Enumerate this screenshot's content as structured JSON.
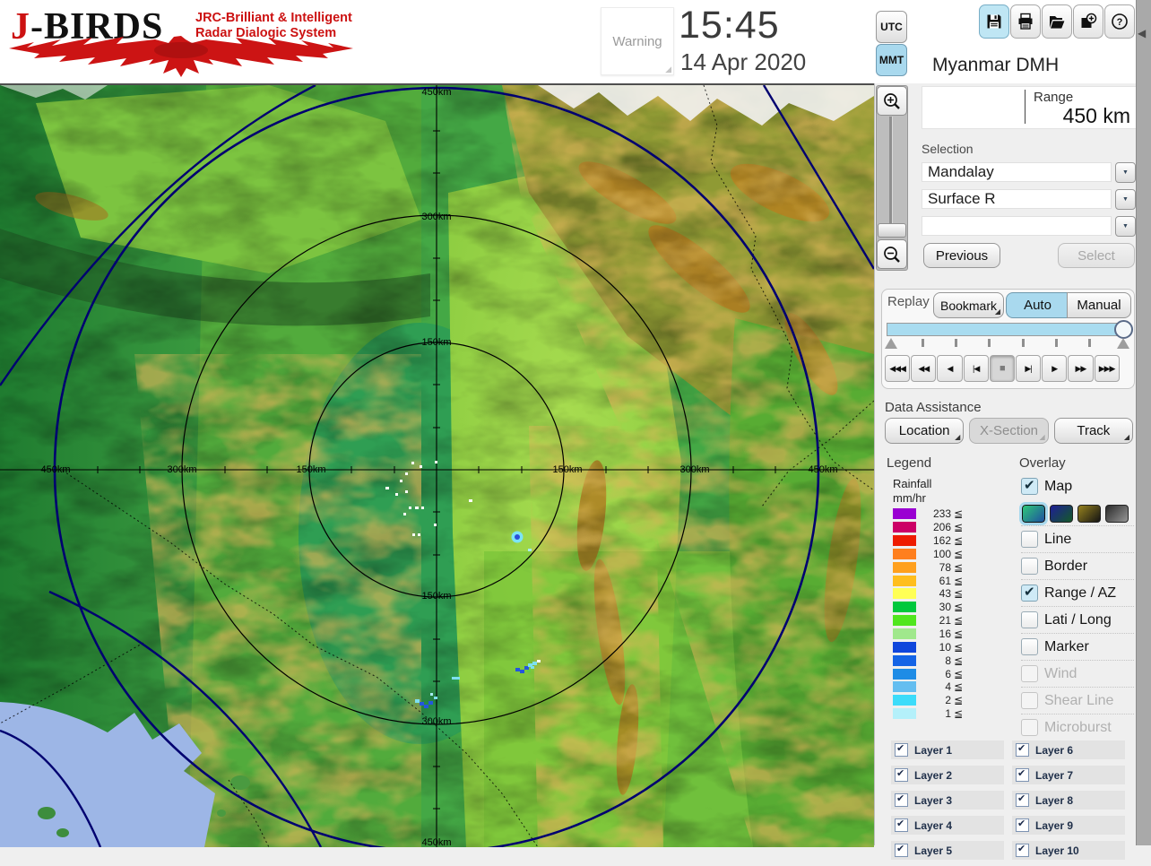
{
  "header": {
    "logo": {
      "j": "J",
      "rest": "-BIRDS",
      "sub1": "JRC-Brilliant & Intelligent",
      "sub2": "Radar  Dialogic  System"
    },
    "warning_label": "Warning",
    "clock": {
      "time": "15:45",
      "date": "14 Apr 2020"
    },
    "timezone": {
      "utc": "UTC",
      "mmt": "MMT",
      "selected": "MMT"
    },
    "toolbar_icons": [
      "save",
      "print",
      "open",
      "export-image",
      "help"
    ]
  },
  "station_panel": {
    "station_name": "Myanmar DMH",
    "range_label": "Range",
    "range_value": "450 km",
    "selection_label": "Selection",
    "dropdowns": [
      {
        "value": "Mandalay"
      },
      {
        "value": "Surface R"
      },
      {
        "value": ""
      }
    ],
    "previous_label": "Previous",
    "select_label": "Select"
  },
  "replay": {
    "label": "Replay",
    "bookmark_label": "Bookmark",
    "auto_label": "Auto",
    "manual_label": "Manual",
    "mode_selected": "Auto",
    "playback_buttons": [
      {
        "glyph": "◀◀◀",
        "name": "fast-rewind"
      },
      {
        "glyph": "◀◀",
        "name": "rewind"
      },
      {
        "glyph": "◀",
        "name": "play-backward"
      },
      {
        "glyph": "|◀",
        "name": "step-back"
      },
      {
        "glyph": "■",
        "name": "stop",
        "pressed": true
      },
      {
        "glyph": "▶|",
        "name": "step-forward"
      },
      {
        "glyph": "▶",
        "name": "play"
      },
      {
        "glyph": "▶▶",
        "name": "fast-forward"
      },
      {
        "glyph": "▶▶▶",
        "name": "skip-to-end"
      }
    ]
  },
  "data_assistance": {
    "label": "Data Assistance",
    "buttons": [
      {
        "label": "Location",
        "disabled": false
      },
      {
        "label": "X-Section",
        "disabled": true
      },
      {
        "label": "Track",
        "disabled": false
      }
    ]
  },
  "legend": {
    "label": "Legend",
    "unit1": "Rainfall",
    "unit2": "mm/hr",
    "lte": "≦",
    "rows": [
      {
        "value": "233",
        "color": "#9a00d2"
      },
      {
        "value": "206",
        "color": "#cc0066"
      },
      {
        "value": "162",
        "color": "#ee1c00"
      },
      {
        "value": "100",
        "color": "#ff7f1e"
      },
      {
        "value": "78",
        "color": "#ffa01e"
      },
      {
        "value": "61",
        "color": "#ffbe1e"
      },
      {
        "value": "43",
        "color": "#ffff55"
      },
      {
        "value": "30",
        "color": "#00c83c"
      },
      {
        "value": "21",
        "color": "#50e61e"
      },
      {
        "value": "16",
        "color": "#a0e88c"
      },
      {
        "value": "10",
        "color": "#0f46dc"
      },
      {
        "value": "8",
        "color": "#1464e6"
      },
      {
        "value": "6",
        "color": "#1e8ce6"
      },
      {
        "value": "4",
        "color": "#64bef0"
      },
      {
        "value": "2",
        "color": "#3cdcfa"
      },
      {
        "value": "1",
        "color": "#b4f0fa"
      }
    ]
  },
  "overlay": {
    "label": "Overlay",
    "items_top": [
      {
        "label": "Map",
        "checked": true
      }
    ],
    "swatches": [
      {
        "gradient": "linear-gradient(135deg,#2ec878,#1e50a0)",
        "selected": true
      },
      {
        "gradient": "linear-gradient(135deg,#1e1e96,#145a28)"
      },
      {
        "gradient": "linear-gradient(135deg,#96821e,#141414)"
      },
      {
        "gradient": "linear-gradient(135deg,#2a2a2a,#969696)"
      }
    ],
    "items": [
      {
        "label": "Line"
      },
      {
        "label": "Border"
      },
      {
        "label": "Range / AZ",
        "checked": true
      },
      {
        "label": "Lati / Long"
      },
      {
        "label": "Marker"
      },
      {
        "label": "Wind",
        "disabled": true
      },
      {
        "label": "Shear Line",
        "disabled": true
      },
      {
        "label": "Microburst",
        "disabled": true
      }
    ]
  },
  "layers": {
    "left": [
      {
        "label": "Layer 1",
        "checked": true
      },
      {
        "label": "Layer 2",
        "checked": true
      },
      {
        "label": "Layer 3",
        "checked": true
      },
      {
        "label": "Layer 4",
        "checked": true
      },
      {
        "label": "Layer 5",
        "checked": true
      }
    ],
    "right": [
      {
        "label": "Layer 6",
        "checked": true
      },
      {
        "label": "Layer 7",
        "checked": true
      },
      {
        "label": "Layer 8",
        "checked": true
      },
      {
        "label": "Layer 9",
        "checked": true
      },
      {
        "label": "Layer 10",
        "checked": true
      }
    ]
  },
  "map": {
    "station": "Mandalay",
    "ring_color": "#000070",
    "ring_labels": [
      "450km",
      "300km",
      "150km",
      "150km",
      "300km",
      "450km",
      "450km",
      "300km",
      "150km",
      "150km",
      "300km",
      "450km"
    ]
  },
  "ui_colors": {
    "accent_blue": "#a9d9ee",
    "logo_red": "#cc1212"
  }
}
